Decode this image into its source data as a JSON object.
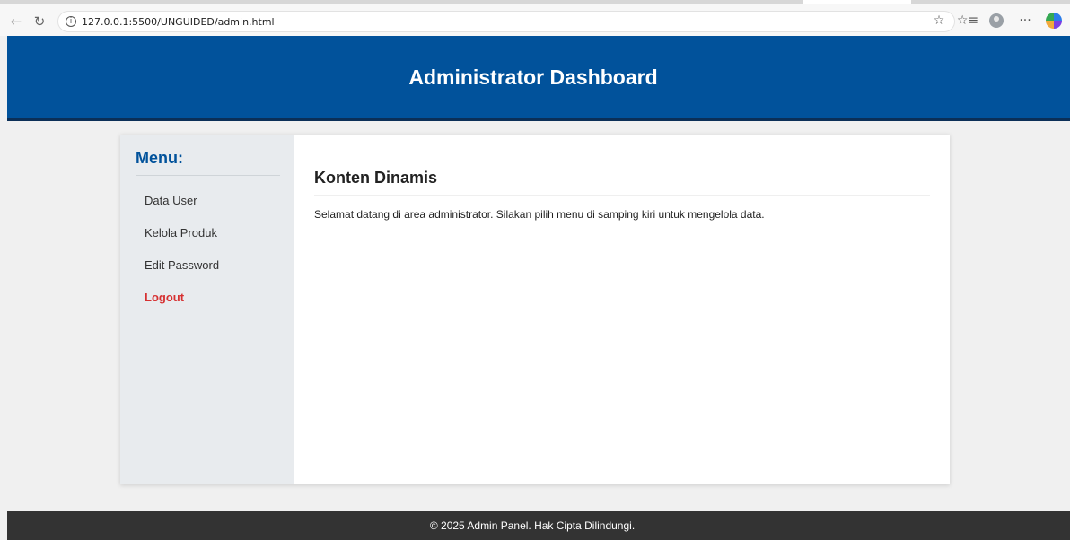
{
  "browser": {
    "url": "127.0.0.1:5500/UNGUIDED/admin.html",
    "icons": [
      "back-icon",
      "reload-icon",
      "info-icon",
      "star-icon",
      "favorites-icon",
      "profile-icon",
      "more-icon",
      "copilot-icon"
    ],
    "glyphs": {
      "back": "←",
      "reload": "↻",
      "info": "i",
      "star": "☆",
      "favorites": "☆≡",
      "more": "···"
    }
  },
  "header": {
    "title": "Administrator Dashboard",
    "bg_color": "#01529b"
  },
  "sidebar": {
    "title": "Menu:",
    "items": [
      {
        "label": "Data User"
      },
      {
        "label": "Kelola Produk"
      },
      {
        "label": "Edit Password"
      },
      {
        "label": "Logout",
        "color": "#d63031"
      }
    ]
  },
  "main": {
    "title": "Konten Dinamis",
    "text": "Selamat datang di area administrator. Silakan pilih menu di samping kiri untuk mengelola data."
  },
  "footer": {
    "text": "© 2025 Admin Panel. Hak Cipta Dilindungi.",
    "bg_color": "#333333"
  }
}
